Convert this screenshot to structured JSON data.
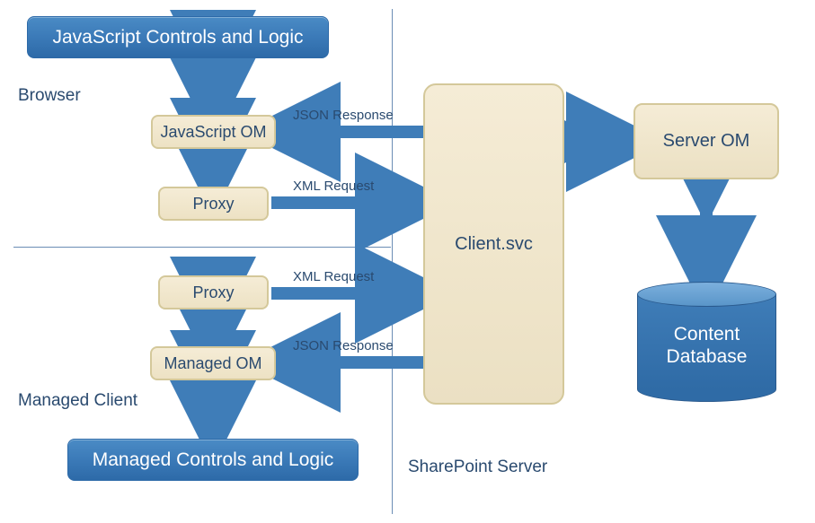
{
  "sections": {
    "browser": "Browser",
    "managed_client": "Managed Client",
    "sharepoint_server": "SharePoint Server"
  },
  "nodes": {
    "js_controls": "JavaScript Controls and Logic",
    "js_om": "JavaScript OM",
    "proxy_top": "Proxy",
    "proxy_bottom": "Proxy",
    "managed_om": "Managed OM",
    "managed_controls": "Managed Controls and Logic",
    "client_svc": "Client.svc",
    "server_om": "Server OM",
    "content_db_line1": "Content",
    "content_db_line2": "Database"
  },
  "edges": {
    "json_response_top": "JSON Response",
    "xml_request_top": "XML Request",
    "xml_request_bottom": "XML Request",
    "json_response_bottom": "JSON Response"
  },
  "colors": {
    "blue": "#3b7ab8",
    "tan": "#ede2c4",
    "text": "#2a4a6f"
  }
}
